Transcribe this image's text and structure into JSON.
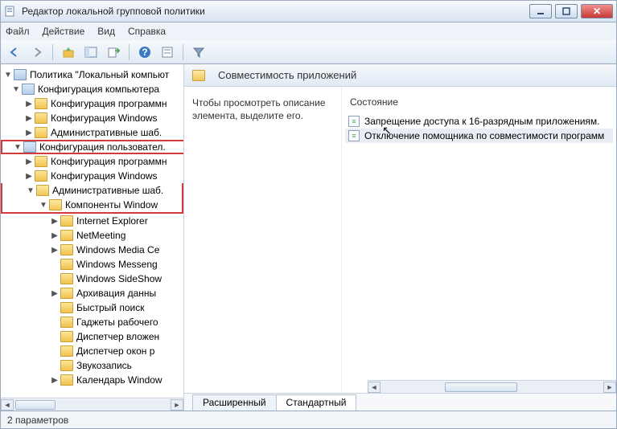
{
  "window": {
    "title": "Редактор локальной групповой политики"
  },
  "menu": {
    "file": "Файл",
    "action": "Действие",
    "view": "Вид",
    "help": "Справка"
  },
  "tree": {
    "root": "Политика \"Локальный компьют",
    "comp_cfg": "Конфигурация компьютера",
    "comp_soft": "Конфигурация программн",
    "comp_win": "Конфигурация Windows",
    "comp_adm": "Административные шаб.",
    "user_cfg": "Конфигурация пользовател.",
    "user_soft": "Конфигурация программн",
    "user_win": "Конфигурация Windows",
    "user_adm": "Административные шаб.",
    "user_comp_win": "Компоненты Window",
    "ie": "Internet Explorer",
    "nm": "NetMeeting",
    "wmc": "Windows Media Ce",
    "wmsg": "Windows Messeng",
    "wss": "Windows SideShow",
    "arch": "Архивация данны",
    "fast": "Быстрый поиск",
    "gadget": "Гаджеты рабочего",
    "attmgr": "Диспетчер вложен",
    "winmgr": "Диспетчер окон р",
    "sound": "Звукозапись",
    "cal": "Календарь Window"
  },
  "right": {
    "title": "Совместимость приложений",
    "desc": "Чтобы просмотреть описание элемента, выделите его.",
    "state_header": "Состояние",
    "items": [
      "Запрещение доступа к 16-разрядным приложениям.",
      "Отключение помощника по совместимости программ"
    ],
    "tabs": {
      "ext": "Расширенный",
      "std": "Стандартный"
    }
  },
  "status": {
    "text": "2 параметров"
  }
}
